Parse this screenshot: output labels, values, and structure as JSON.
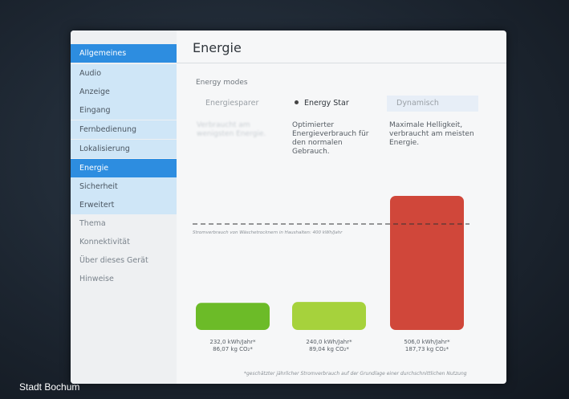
{
  "sidebar": {
    "items": [
      {
        "label": "Allgemeines",
        "style": "active"
      },
      {
        "label": "Audio",
        "style": "light"
      },
      {
        "label": "Anzeige",
        "style": "light"
      },
      {
        "label": "Eingang",
        "style": "light"
      },
      {
        "label": "Fernbedienung",
        "style": "light"
      },
      {
        "label": "Lokalisierung",
        "style": "light"
      },
      {
        "label": "Energie",
        "style": "active"
      },
      {
        "label": "Sicherheit",
        "style": "light"
      },
      {
        "label": "Erweitert",
        "style": "light"
      },
      {
        "label": "Thema",
        "style": "plain"
      },
      {
        "label": "Konnektivität",
        "style": "plain"
      },
      {
        "label": "Über dieses Gerät",
        "style": "plain"
      },
      {
        "label": "Hinweise",
        "style": "plain"
      }
    ]
  },
  "header": {
    "title": "Energie"
  },
  "energy": {
    "section_label": "Energy modes",
    "modes": [
      {
        "label": "Energiesparer",
        "desc": "Verbraucht am wenigsten Energie."
      },
      {
        "label": "Energy Star",
        "desc": "Optimierter Energieverbrauch für den normalen Gebrauch."
      },
      {
        "label": "Dynamisch",
        "desc": "Maximale Helligkeit, verbraucht am meisten Energie."
      }
    ]
  },
  "chart_data": {
    "type": "bar",
    "categories": [
      "Energiesparer",
      "Energy Star",
      "Dynamisch"
    ],
    "values": [
      232.0,
      240.0,
      506.0
    ],
    "value_labels": [
      "232,0 kWh/Jahr*",
      "240,0 kWh/Jahr*",
      "506,0 kWh/Jahr*"
    ],
    "co2_labels": [
      "86,07 kg CO₂*",
      "89,04 kg CO₂*",
      "187,73 kg CO₂*"
    ],
    "colors": [
      "#6cbb28",
      "#a6d23c",
      "#d0473a"
    ],
    "reference_line": {
      "value": 400,
      "label": "Stromverbrauch von Wäschetrocknern in Haushalten: 400 kWh/Jahr"
    },
    "ylim": [
      0,
      506
    ],
    "grid": false
  },
  "footnote": "*geschätzter jährlicher Stromverbrauch auf der Grundlage einer durchschnittlichen Nutzung",
  "caption": "Stadt Bochum"
}
